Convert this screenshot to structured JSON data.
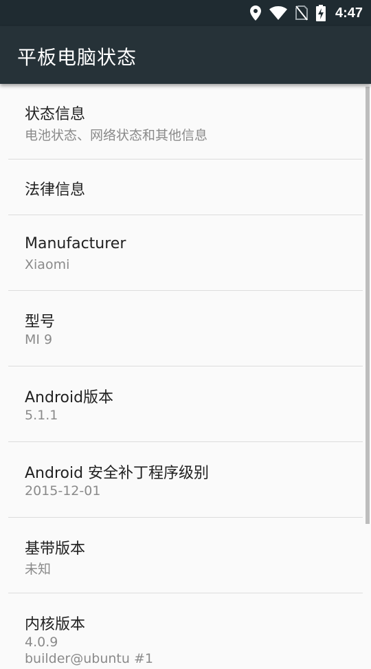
{
  "status_bar": {
    "time": "4:47",
    "icons": [
      "location-icon",
      "wifi-icon",
      "no-sim-icon",
      "battery-charging-icon"
    ]
  },
  "app_bar": {
    "title": "平板电脑状态"
  },
  "items": [
    {
      "title": "状态信息",
      "subtitle": "电池状态、网络状态和其他信息"
    },
    {
      "title": "法律信息"
    },
    {
      "title": "Manufacturer",
      "subtitle": "Xiaomi"
    },
    {
      "title": "型号",
      "subtitle": "MI 9"
    },
    {
      "title": "Android版本",
      "subtitle": "5.1.1"
    },
    {
      "title": "Android 安全补丁程序级别",
      "subtitle": "2015-12-01"
    },
    {
      "title": "基带版本",
      "subtitle": "未知"
    },
    {
      "title": "内核版本",
      "subtitle": "4.0.9",
      "subtitle2": "builder@ubuntu #1"
    }
  ]
}
